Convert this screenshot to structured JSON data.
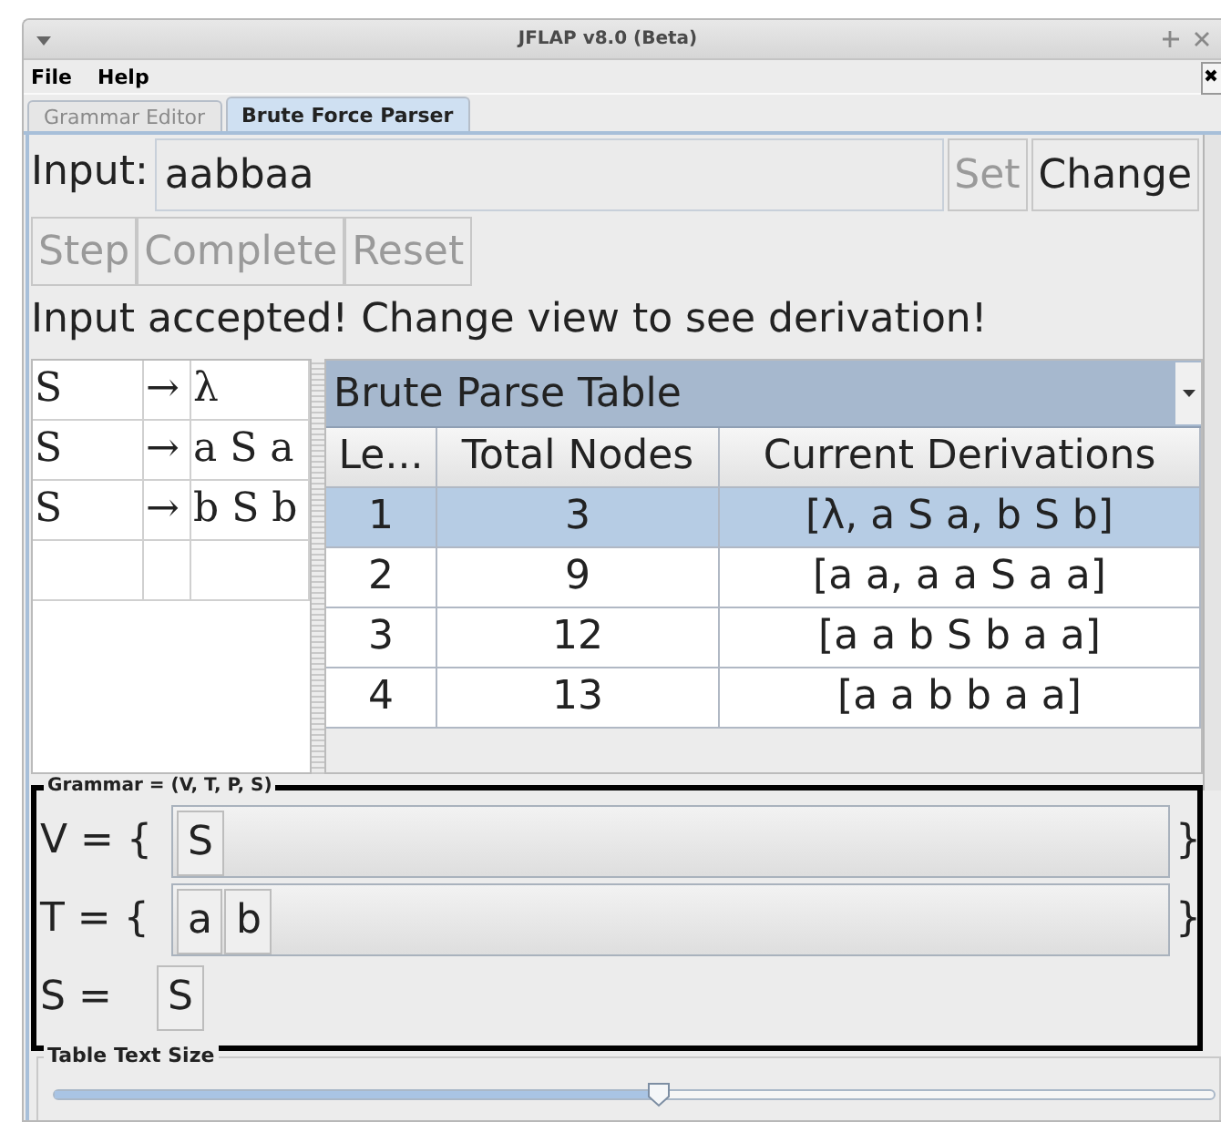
{
  "window": {
    "title": "JFLAP v8.0 (Beta)"
  },
  "menu": [
    "File",
    "Help"
  ],
  "tabs": [
    {
      "label": "Grammar Editor",
      "selected": false
    },
    {
      "label": "Brute Force Parser",
      "selected": true
    }
  ],
  "input": {
    "label": "Input:",
    "value": "aabbaa"
  },
  "input_buttons": [
    {
      "label": "Set",
      "disabled": true
    },
    {
      "label": "Change",
      "disabled": false
    }
  ],
  "controls": [
    {
      "label": "Step",
      "disabled": true
    },
    {
      "label": "Complete",
      "disabled": true
    },
    {
      "label": "Reset",
      "disabled": true
    }
  ],
  "message": "Input accepted! Change view to see derivation!",
  "productions": [
    {
      "lhs": "S",
      "arrow": "→",
      "rhs": "λ"
    },
    {
      "lhs": "S",
      "arrow": "→",
      "rhs": "a S a"
    },
    {
      "lhs": "S",
      "arrow": "→",
      "rhs": "b S b"
    }
  ],
  "parse_table": {
    "view": "Brute Parse Table",
    "columns": [
      "Le...",
      "Total Nodes",
      "Current Derivations"
    ],
    "rows": [
      {
        "cells": [
          "1",
          "3",
          "[λ, a S a, b S b]"
        ],
        "selected": true
      },
      {
        "cells": [
          "2",
          "9",
          "[a a, a a S a a]"
        ],
        "selected": false
      },
      {
        "cells": [
          "3",
          "12",
          "[a a b S b a a]"
        ],
        "selected": false
      },
      {
        "cells": [
          "4",
          "13",
          "[a a b b a a]"
        ],
        "selected": false
      }
    ]
  },
  "grammar": {
    "title": "Grammar = (V, T, P, S)",
    "sets": [
      {
        "label": "V = {",
        "symbols": [
          "S"
        ],
        "close": "}"
      },
      {
        "label": "T = {",
        "symbols": [
          "a",
          "b"
        ],
        "close": "}"
      }
    ],
    "start": {
      "label": "S =",
      "symbol": "S"
    }
  },
  "text_size": {
    "title": "Table Text Size",
    "level": 0.52
  }
}
